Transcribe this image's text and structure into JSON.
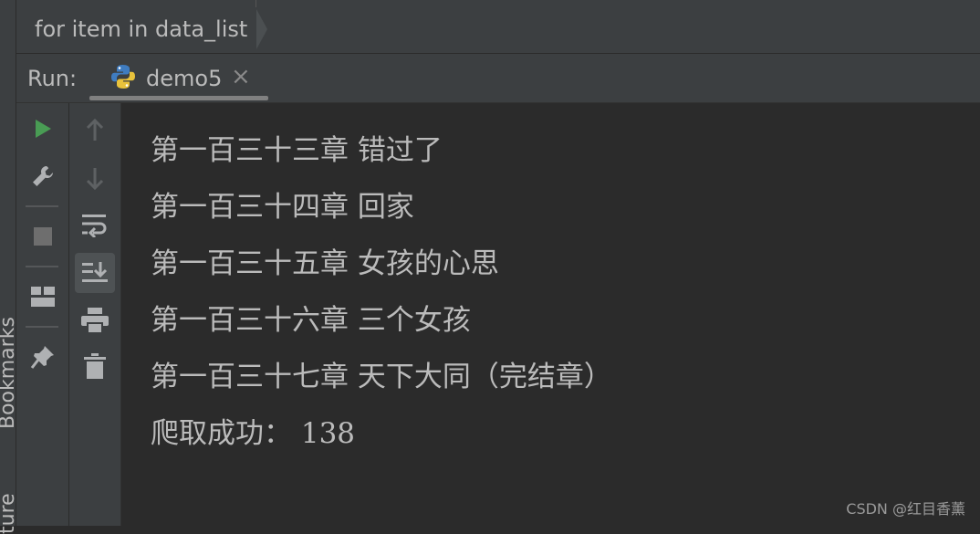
{
  "left_strip": {
    "tabs": [
      "Bookmarks",
      "ture"
    ]
  },
  "breadcrumb": {
    "text": "for item in data_list"
  },
  "run_bar": {
    "label": "Run:",
    "tab": {
      "name": "demo5",
      "icon": "python-icon",
      "close": "×"
    }
  },
  "toolbar_left": {
    "buttons": [
      {
        "icon": "rerun-play-icon",
        "color": "#499c54"
      },
      {
        "icon": "wrench-icon"
      },
      {
        "icon": "stop-icon"
      },
      {
        "icon": "layout-icon"
      },
      {
        "icon": "pin-icon"
      }
    ]
  },
  "toolbar_right": {
    "buttons": [
      {
        "icon": "arrow-up-icon"
      },
      {
        "icon": "arrow-down-icon"
      },
      {
        "icon": "soft-wrap-icon"
      },
      {
        "icon": "scroll-to-end-icon",
        "active": true
      },
      {
        "icon": "print-icon"
      },
      {
        "icon": "trash-icon"
      }
    ]
  },
  "console": {
    "lines": [
      "第一百三十三章 错过了",
      "第一百三十四章 回家",
      "第一百三十五章 女孩的心思",
      "第一百三十六章 三个女孩",
      "第一百三十七章 天下大同（完结章）",
      "爬取成功： 138"
    ]
  },
  "watermark": "CSDN @红目香薰"
}
